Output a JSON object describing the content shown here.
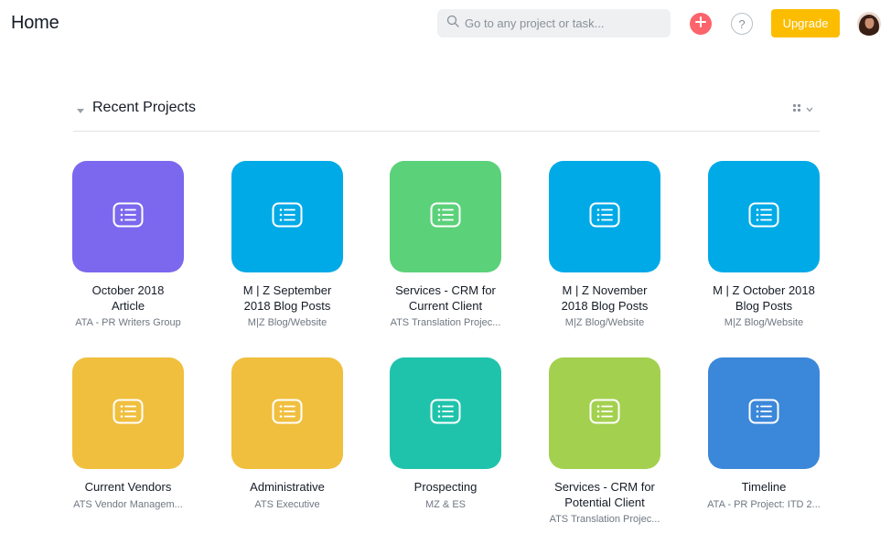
{
  "header": {
    "title": "Home",
    "search_placeholder": "Go to any project or task...",
    "upgrade_label": "Upgrade",
    "help_label": "?"
  },
  "section": {
    "title": "Recent Projects"
  },
  "projects": [
    {
      "name_line1": "October 2018",
      "name_line2": "Article",
      "team": "ATA - PR Writers Group",
      "color": "#7b68ee"
    },
    {
      "name_line1": "M | Z September",
      "name_line2": "2018 Blog Posts",
      "team": "M|Z Blog/Website",
      "color": "#00aae7"
    },
    {
      "name_line1": "Services - CRM for",
      "name_line2": "Current Client",
      "team": "ATS Translation Projec...",
      "color": "#5bd17a"
    },
    {
      "name_line1": "M | Z November",
      "name_line2": "2018 Blog Posts",
      "team": "M|Z Blog/Website",
      "color": "#00aae7"
    },
    {
      "name_line1": "M | Z October 2018",
      "name_line2": "Blog Posts",
      "team": "M|Z Blog/Website",
      "color": "#00aae7"
    },
    {
      "name_line1": "Current Vendors",
      "name_line2": "",
      "team": "ATS Vendor Managem...",
      "color": "#f0bf3e"
    },
    {
      "name_line1": "Administrative",
      "name_line2": "",
      "team": "ATS Executive",
      "color": "#f0bf3e"
    },
    {
      "name_line1": "Prospecting",
      "name_line2": "",
      "team": "MZ & ES",
      "color": "#1fc3ab"
    },
    {
      "name_line1": "Services - CRM for",
      "name_line2": "Potential Client",
      "team": "ATS Translation Projec...",
      "color": "#a3d04e"
    },
    {
      "name_line1": "Timeline",
      "name_line2": "",
      "team": "ATA - PR Project: ITD 2...",
      "color": "#3b87d9"
    }
  ]
}
